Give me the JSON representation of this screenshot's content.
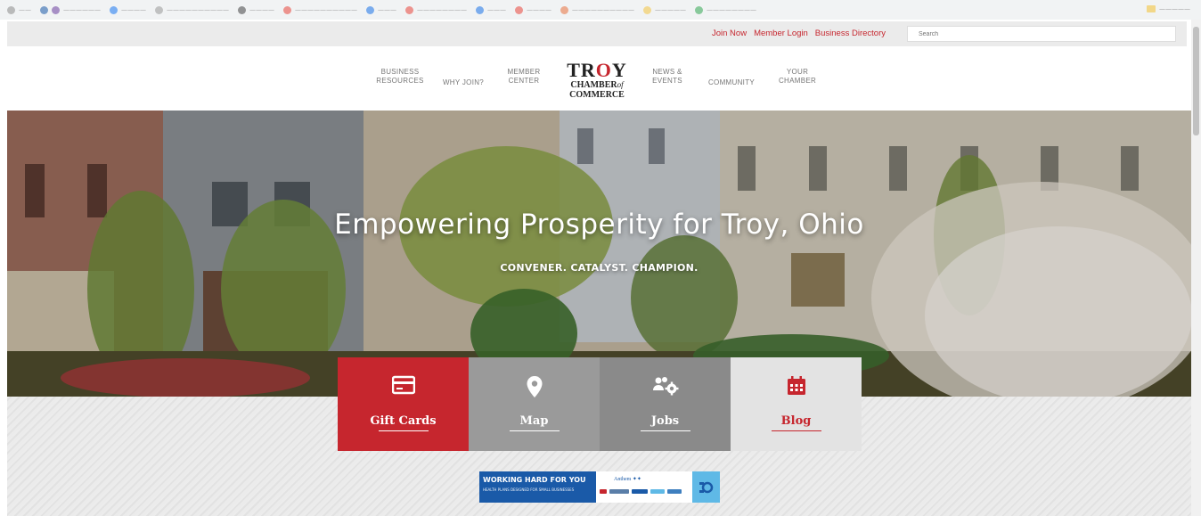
{
  "utility": {
    "links": [
      "Join Now",
      "Member Login",
      "Business Directory"
    ],
    "search_placeholder": "Search"
  },
  "nav": {
    "left": [
      {
        "line1": "BUSINESS",
        "line2": "RESOURCES"
      },
      {
        "line1": "WHY JOIN?",
        "line2": ""
      },
      {
        "line1": "MEMBER",
        "line2": "CENTER"
      }
    ],
    "right": [
      {
        "line1": "NEWS &",
        "line2": "EVENTS"
      },
      {
        "line1": "COMMUNITY",
        "line2": ""
      },
      {
        "line1": "YOUR",
        "line2": "CHAMBER"
      }
    ]
  },
  "logo": {
    "brand": "TROY",
    "chamber": "CHAMBER",
    "of": "of",
    "commerce": "COMMERCE"
  },
  "hero": {
    "title": "Empowering Prosperity for Troy, Ohio",
    "subtitle": "CONVENER. CATALYST. CHAMPION."
  },
  "tiles": [
    {
      "label": "Gift Cards",
      "icon": "credit-card-icon",
      "bg": "#c6262e",
      "fg": "#ffffff"
    },
    {
      "label": "Map",
      "icon": "map-pin-icon",
      "bg": "#9a9a9a",
      "fg": "#ffffff"
    },
    {
      "label": "Jobs",
      "icon": "people-gear-icon",
      "bg": "#8a8a8a",
      "fg": "#ffffff"
    },
    {
      "label": "Blog",
      "icon": "calendar-icon",
      "bg": "#e3e3e3",
      "fg": "#c6262e"
    }
  ],
  "ad": {
    "headline": "WORKING HARD FOR YOU",
    "subline": "HEALTH PLANS DESIGNED FOR SMALL BUSINESSES",
    "sponsor": "Anthem"
  },
  "colors": {
    "accent": "#c6262e",
    "utility_bg": "#ebebeb",
    "ad_blue": "#1a5aa8"
  }
}
